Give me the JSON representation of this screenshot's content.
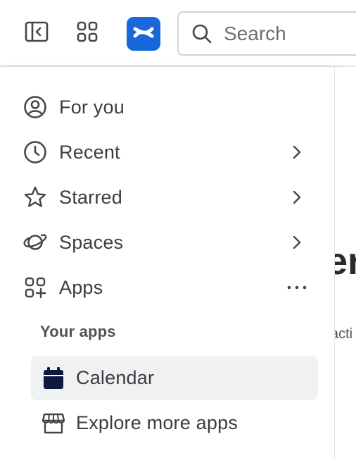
{
  "topbar": {
    "sidebar_toggle_icon": "sidebar-collapse-icon",
    "app_switcher_icon": "app-grid-icon",
    "logo_icon": "confluence-logo-icon",
    "brand_color": "#1868db",
    "search": {
      "placeholder": "Search",
      "value": ""
    }
  },
  "sidebar": {
    "items": [
      {
        "label": "For you",
        "icon": "user-circle-icon"
      },
      {
        "label": "Recent",
        "icon": "clock-icon",
        "trailing": "chevron-right-icon"
      },
      {
        "label": "Starred",
        "icon": "star-icon",
        "trailing": "chevron-right-icon"
      },
      {
        "label": "Spaces",
        "icon": "planet-icon",
        "trailing": "chevron-right-icon"
      },
      {
        "label": "Apps",
        "icon": "apps-add-icon",
        "trailing": "more-horizontal-icon"
      }
    ],
    "section_heading": "Your apps",
    "apps": [
      {
        "label": "Calendar",
        "icon": "calendar-icon",
        "selected": true
      },
      {
        "label": "Explore more apps",
        "icon": "storefront-icon",
        "selected": false
      }
    ]
  },
  "main_peek": {
    "heading_fragment": "er",
    "text_fragment": "acti"
  }
}
